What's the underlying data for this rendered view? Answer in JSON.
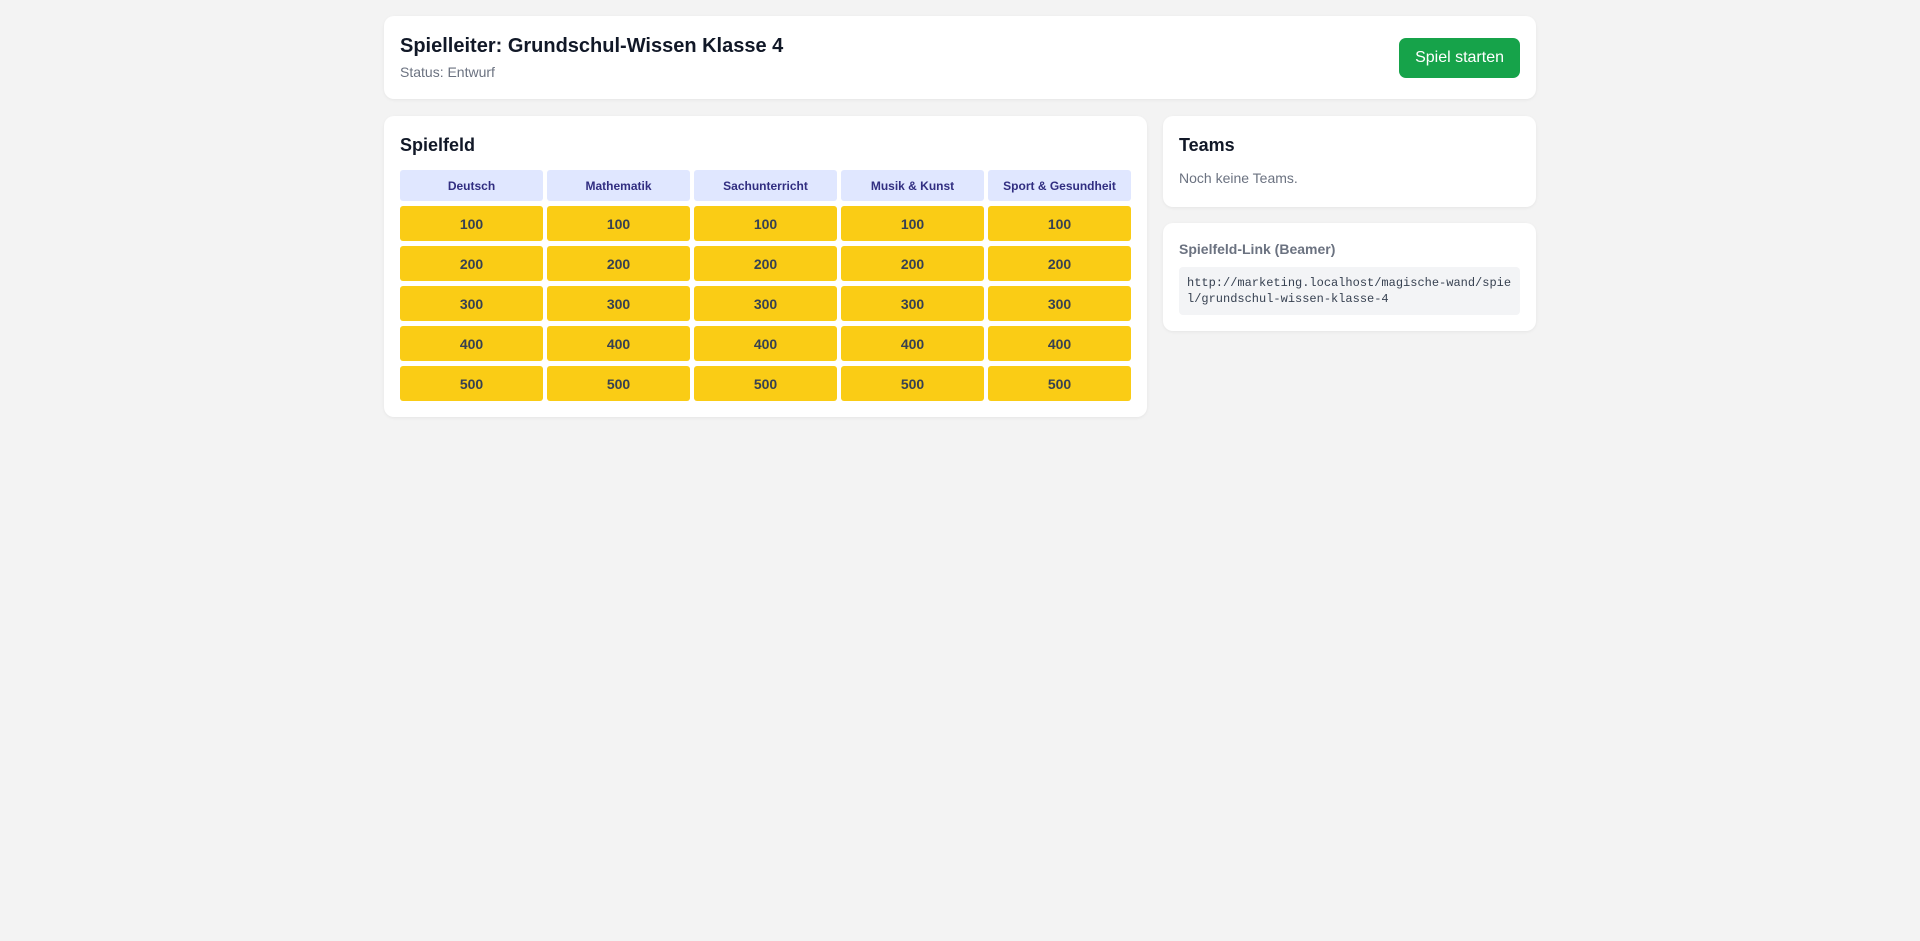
{
  "header": {
    "title": "Spielleiter: Grundschul-Wissen Klasse 4",
    "status": "Status: Entwurf",
    "start_button_label": "Spiel starten"
  },
  "board": {
    "title": "Spielfeld",
    "categories": [
      "Deutsch",
      "Mathematik",
      "Sachunterricht",
      "Musik & Kunst",
      "Sport & Gesundheit"
    ],
    "rows": [
      [
        "100",
        "100",
        "100",
        "100",
        "100"
      ],
      [
        "200",
        "200",
        "200",
        "200",
        "200"
      ],
      [
        "300",
        "300",
        "300",
        "300",
        "300"
      ],
      [
        "400",
        "400",
        "400",
        "400",
        "400"
      ],
      [
        "500",
        "500",
        "500",
        "500",
        "500"
      ]
    ]
  },
  "teams": {
    "title": "Teams",
    "empty_text": "Noch keine Teams."
  },
  "beamer_link": {
    "label": "Spielfeld-Link (Beamer)",
    "url": "http://marketing.localhost/magische-wand/spiel/grundschul-wissen-klasse-4"
  },
  "colors": {
    "accent_green": "#16a34a",
    "tile_yellow": "#facc15",
    "category_bg": "#e0e7ff",
    "category_text": "#312e81"
  }
}
